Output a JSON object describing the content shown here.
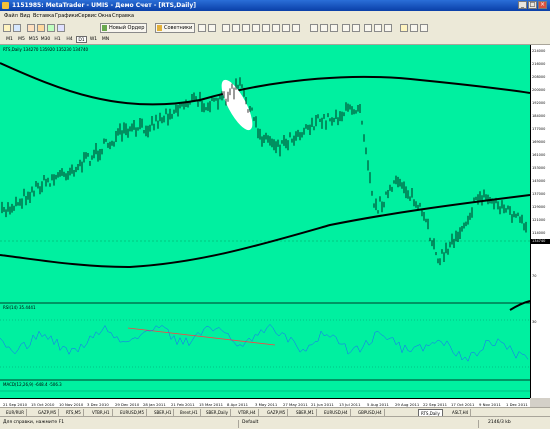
{
  "window": {
    "title": "1151985: MetaTrader - UMIS - Демо Счет - [RTS,Daily]",
    "minimize_icon": "minimize-icon",
    "maximize_icon": "maximize-icon",
    "close_icon": "close-icon"
  },
  "menu": [
    "Файл",
    "Вид",
    "Вставка",
    "Графики",
    "Сервис",
    "Окна",
    "Справка"
  ],
  "toolbar": {
    "new_order_label": "Новый Ордер",
    "advisors_label": "Советники",
    "icons": [
      "new-chart-icon",
      "profiles-icon",
      "market-watch-icon",
      "navigator-icon",
      "terminal-icon",
      "strategy-tester-icon",
      "cursor-icon",
      "crosshair-icon",
      "vertical-line-icon",
      "horizontal-line-icon",
      "trend-line-icon",
      "channel-icon",
      "fibonacci-icon",
      "text-icon",
      "label-icon",
      "arrows-icon",
      "bar-chart-icon",
      "candles-icon",
      "line-chart-icon",
      "zoom-in-icon",
      "zoom-out-icon",
      "tile-icon",
      "autoscroll-icon",
      "shift-icon",
      "indicators-icon",
      "periods-icon",
      "templates-icon"
    ]
  },
  "timeframes": [
    "M1",
    "M5",
    "M15",
    "M30",
    "H1",
    "H4",
    "D1",
    "W1",
    "MN"
  ],
  "timeframe_selected": "D1",
  "chart": {
    "title": "RTS,Daily 134270 135920 135230 134740",
    "rsi_label": "RSI(14) 35.4441",
    "macd_label": "MACD(12,26,9) -648.4 -506.3",
    "price_tag": "134740",
    "y_labels": [
      "224000",
      "216000",
      "208000",
      "200000",
      "192000",
      "184000",
      "177000",
      "169000",
      "161000",
      "153000",
      "145000",
      "137000",
      "129000",
      "121000",
      "114000"
    ],
    "rsi_y_labels": [
      "70",
      "30"
    ],
    "x_labels": [
      "21 Sep 2010",
      "15 Oct 2010",
      "10 Nov 2010",
      "3 Dec 2010",
      "29 Dec 2010",
      "28 Jan 2011",
      "21 Feb 2011",
      "15 Mar 2011",
      "8 Apr 2011",
      "3 May 2011",
      "27 May 2011",
      "21 Jun 2011",
      "13 Jul 2011",
      "5 Aug 2011",
      "29 Aug 2011",
      "22 Sep 2011",
      "17 Oct 2011",
      "9 Nov 2011",
      "1 Dec 2011"
    ],
    "colors": {
      "background": "#00f0a0",
      "bars": "#000000",
      "trendline": "#ff4040",
      "highlight": "#ffffff"
    }
  },
  "tabs": [
    "EURUSD,H4",
    "GBPUSD,H4",
    "RTS,Daily",
    "ASLT,H4"
  ],
  "tabs_left": [
    "EUR/RUR",
    "GAZP,M5",
    "RTS,M5",
    "VTBR,H1",
    "EURUSD,M5",
    "SBER,H1",
    "Brent,H1",
    "SBER,Daily",
    "VTBR,H4",
    "GAZP,M5",
    "SBER,M1"
  ],
  "active_tab": "RTS,Daily",
  "status": {
    "help": "Для справки, нажмите F1",
    "profile": "Default",
    "traffic": "2146/3 kb"
  }
}
